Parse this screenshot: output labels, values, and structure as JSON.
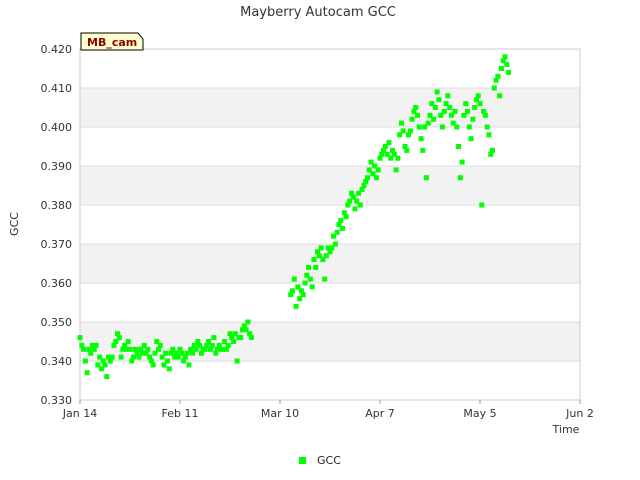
{
  "chart_data": {
    "type": "scatter",
    "title": "Mayberry Autocam GCC",
    "xlabel": "Time",
    "ylabel": "GCC",
    "site_tag": "MB_cam",
    "x_ticks": [
      "Jan 14",
      "Feb 11",
      "Mar 10",
      "Apr 7",
      "May 5",
      "Jun 2"
    ],
    "x_tick_days": [
      0,
      28,
      56,
      84,
      112,
      140
    ],
    "xlim_days": [
      0,
      140
    ],
    "ylim": [
      0.33,
      0.42
    ],
    "y_ticks": [
      "0.330",
      "0.340",
      "0.350",
      "0.360",
      "0.370",
      "0.380",
      "0.390",
      "0.400",
      "0.410",
      "0.420"
    ],
    "grid": true,
    "banding": true,
    "legend_position": "bottom-center",
    "series": [
      {
        "name": "GCC",
        "color": "#00ff00",
        "points": [
          [
            0,
            0.346
          ],
          [
            0.5,
            0.344
          ],
          [
            1,
            0.343
          ],
          [
            1.5,
            0.34
          ],
          [
            2,
            0.337
          ],
          [
            2.5,
            0.343
          ],
          [
            3,
            0.342
          ],
          [
            3.5,
            0.344
          ],
          [
            4,
            0.343
          ],
          [
            4.5,
            0.344
          ],
          [
            5,
            0.339
          ],
          [
            5.5,
            0.341
          ],
          [
            6,
            0.338
          ],
          [
            6.5,
            0.34
          ],
          [
            7,
            0.339
          ],
          [
            7.5,
            0.336
          ],
          [
            8,
            0.341
          ],
          [
            8.5,
            0.34
          ],
          [
            9,
            0.341
          ],
          [
            9.5,
            0.344
          ],
          [
            10,
            0.345
          ],
          [
            10.5,
            0.347
          ],
          [
            11,
            0.346
          ],
          [
            11.5,
            0.341
          ],
          [
            12,
            0.343
          ],
          [
            12.5,
            0.344
          ],
          [
            13,
            0.343
          ],
          [
            13.5,
            0.345
          ],
          [
            14,
            0.343
          ],
          [
            14.5,
            0.34
          ],
          [
            15,
            0.341
          ],
          [
            15.5,
            0.343
          ],
          [
            16,
            0.342
          ],
          [
            16.5,
            0.341
          ],
          [
            17,
            0.343
          ],
          [
            17.5,
            0.342
          ],
          [
            18,
            0.344
          ],
          [
            18.5,
            0.342
          ],
          [
            19,
            0.343
          ],
          [
            19.5,
            0.341
          ],
          [
            20,
            0.34
          ],
          [
            20.5,
            0.339
          ],
          [
            21,
            0.342
          ],
          [
            21.5,
            0.345
          ],
          [
            22,
            0.343
          ],
          [
            22.5,
            0.344
          ],
          [
            23,
            0.341
          ],
          [
            23.5,
            0.339
          ],
          [
            24,
            0.342
          ],
          [
            24.5,
            0.34
          ],
          [
            25,
            0.338
          ],
          [
            25.5,
            0.342
          ],
          [
            26,
            0.343
          ],
          [
            26.5,
            0.341
          ],
          [
            27,
            0.342
          ],
          [
            27.5,
            0.341
          ],
          [
            28,
            0.343
          ],
          [
            28.5,
            0.342
          ],
          [
            29,
            0.34
          ],
          [
            29.5,
            0.341
          ],
          [
            30,
            0.342
          ],
          [
            30.5,
            0.339
          ],
          [
            31,
            0.343
          ],
          [
            31.5,
            0.342
          ],
          [
            32,
            0.344
          ],
          [
            32.5,
            0.343
          ],
          [
            33,
            0.345
          ],
          [
            33.5,
            0.344
          ],
          [
            34,
            0.342
          ],
          [
            34.5,
            0.343
          ],
          [
            35,
            0.343
          ],
          [
            35.5,
            0.344
          ],
          [
            36,
            0.345
          ],
          [
            36.5,
            0.343
          ],
          [
            37,
            0.344
          ],
          [
            37.5,
            0.346
          ],
          [
            38,
            0.342
          ],
          [
            38.5,
            0.343
          ],
          [
            39,
            0.344
          ],
          [
            39.5,
            0.343
          ],
          [
            40,
            0.343
          ],
          [
            40.5,
            0.345
          ],
          [
            41,
            0.343
          ],
          [
            41.5,
            0.344
          ],
          [
            42,
            0.347
          ],
          [
            42.5,
            0.346
          ],
          [
            43,
            0.345
          ],
          [
            43.5,
            0.347
          ],
          [
            44,
            0.34
          ],
          [
            44.5,
            0.346
          ],
          [
            45,
            0.346
          ],
          [
            45.5,
            0.348
          ],
          [
            46,
            0.349
          ],
          [
            46.5,
            0.348
          ],
          [
            47,
            0.35
          ],
          [
            47.5,
            0.347
          ],
          [
            48,
            0.346
          ],
          [
            59,
            0.357
          ],
          [
            59.5,
            0.358
          ],
          [
            60,
            0.361
          ],
          [
            60.5,
            0.354
          ],
          [
            61,
            0.359
          ],
          [
            61.5,
            0.356
          ],
          [
            62,
            0.358
          ],
          [
            62.5,
            0.357
          ],
          [
            63,
            0.36
          ],
          [
            63.5,
            0.362
          ],
          [
            64,
            0.364
          ],
          [
            64.5,
            0.361
          ],
          [
            65,
            0.359
          ],
          [
            65.5,
            0.366
          ],
          [
            66,
            0.364
          ],
          [
            66.5,
            0.368
          ],
          [
            67,
            0.367
          ],
          [
            67.5,
            0.369
          ],
          [
            68,
            0.366
          ],
          [
            68.5,
            0.361
          ],
          [
            69,
            0.367
          ],
          [
            69.5,
            0.369
          ],
          [
            70,
            0.368
          ],
          [
            70.5,
            0.369
          ],
          [
            71,
            0.372
          ],
          [
            71.5,
            0.37
          ],
          [
            72,
            0.373
          ],
          [
            72.5,
            0.375
          ],
          [
            73,
            0.376
          ],
          [
            73.5,
            0.374
          ],
          [
            74,
            0.378
          ],
          [
            74.5,
            0.377
          ],
          [
            75,
            0.38
          ],
          [
            75.5,
            0.381
          ],
          [
            76,
            0.383
          ],
          [
            76.5,
            0.382
          ],
          [
            77,
            0.379
          ],
          [
            77.5,
            0.381
          ],
          [
            78,
            0.383
          ],
          [
            78.5,
            0.38
          ],
          [
            79,
            0.384
          ],
          [
            79.5,
            0.385
          ],
          [
            80,
            0.386
          ],
          [
            80.5,
            0.387
          ],
          [
            81,
            0.389
          ],
          [
            81.5,
            0.391
          ],
          [
            82,
            0.388
          ],
          [
            82.5,
            0.39
          ],
          [
            83,
            0.387
          ],
          [
            83.5,
            0.389
          ],
          [
            84,
            0.392
          ],
          [
            84.5,
            0.393
          ],
          [
            85,
            0.394
          ],
          [
            85.5,
            0.395
          ],
          [
            86,
            0.393
          ],
          [
            86.5,
            0.396
          ],
          [
            87,
            0.392
          ],
          [
            87.5,
            0.394
          ],
          [
            88,
            0.393
          ],
          [
            88.5,
            0.389
          ],
          [
            89,
            0.392
          ],
          [
            89.5,
            0.398
          ],
          [
            90,
            0.401
          ],
          [
            90.5,
            0.399
          ],
          [
            91,
            0.395
          ],
          [
            91.5,
            0.394
          ],
          [
            92,
            0.398
          ],
          [
            92.5,
            0.399
          ],
          [
            93,
            0.402
          ],
          [
            93.5,
            0.404
          ],
          [
            94,
            0.405
          ],
          [
            94.5,
            0.403
          ],
          [
            95,
            0.4
          ],
          [
            95.5,
            0.397
          ],
          [
            96,
            0.394
          ],
          [
            96.5,
            0.4
          ],
          [
            97,
            0.387
          ],
          [
            97.5,
            0.401
          ],
          [
            98,
            0.403
          ],
          [
            98.5,
            0.406
          ],
          [
            99,
            0.402
          ],
          [
            99.5,
            0.405
          ],
          [
            100,
            0.409
          ],
          [
            100.5,
            0.407
          ],
          [
            101,
            0.403
          ],
          [
            101.5,
            0.4
          ],
          [
            102,
            0.404
          ],
          [
            102.5,
            0.406
          ],
          [
            103,
            0.408
          ],
          [
            103.5,
            0.405
          ],
          [
            104,
            0.403
          ],
          [
            104.5,
            0.401
          ],
          [
            105,
            0.404
          ],
          [
            105.5,
            0.4
          ],
          [
            106,
            0.395
          ],
          [
            106.5,
            0.387
          ],
          [
            107,
            0.391
          ],
          [
            107.5,
            0.403
          ],
          [
            108,
            0.406
          ],
          [
            108.5,
            0.404
          ],
          [
            109,
            0.4
          ],
          [
            109.5,
            0.397
          ],
          [
            110,
            0.402
          ],
          [
            110.5,
            0.405
          ],
          [
            111,
            0.407
          ],
          [
            111.5,
            0.408
          ],
          [
            112,
            0.406
          ],
          [
            112.5,
            0.38
          ],
          [
            113,
            0.404
          ],
          [
            113.5,
            0.403
          ],
          [
            114,
            0.4
          ],
          [
            114.5,
            0.398
          ],
          [
            115,
            0.393
          ],
          [
            115.5,
            0.394
          ],
          [
            116,
            0.41
          ],
          [
            116.5,
            0.412
          ],
          [
            117,
            0.413
          ],
          [
            117.5,
            0.408
          ],
          [
            118,
            0.415
          ],
          [
            118.5,
            0.417
          ],
          [
            119,
            0.418
          ],
          [
            119.5,
            0.416
          ],
          [
            120,
            0.414
          ]
        ]
      }
    ]
  }
}
